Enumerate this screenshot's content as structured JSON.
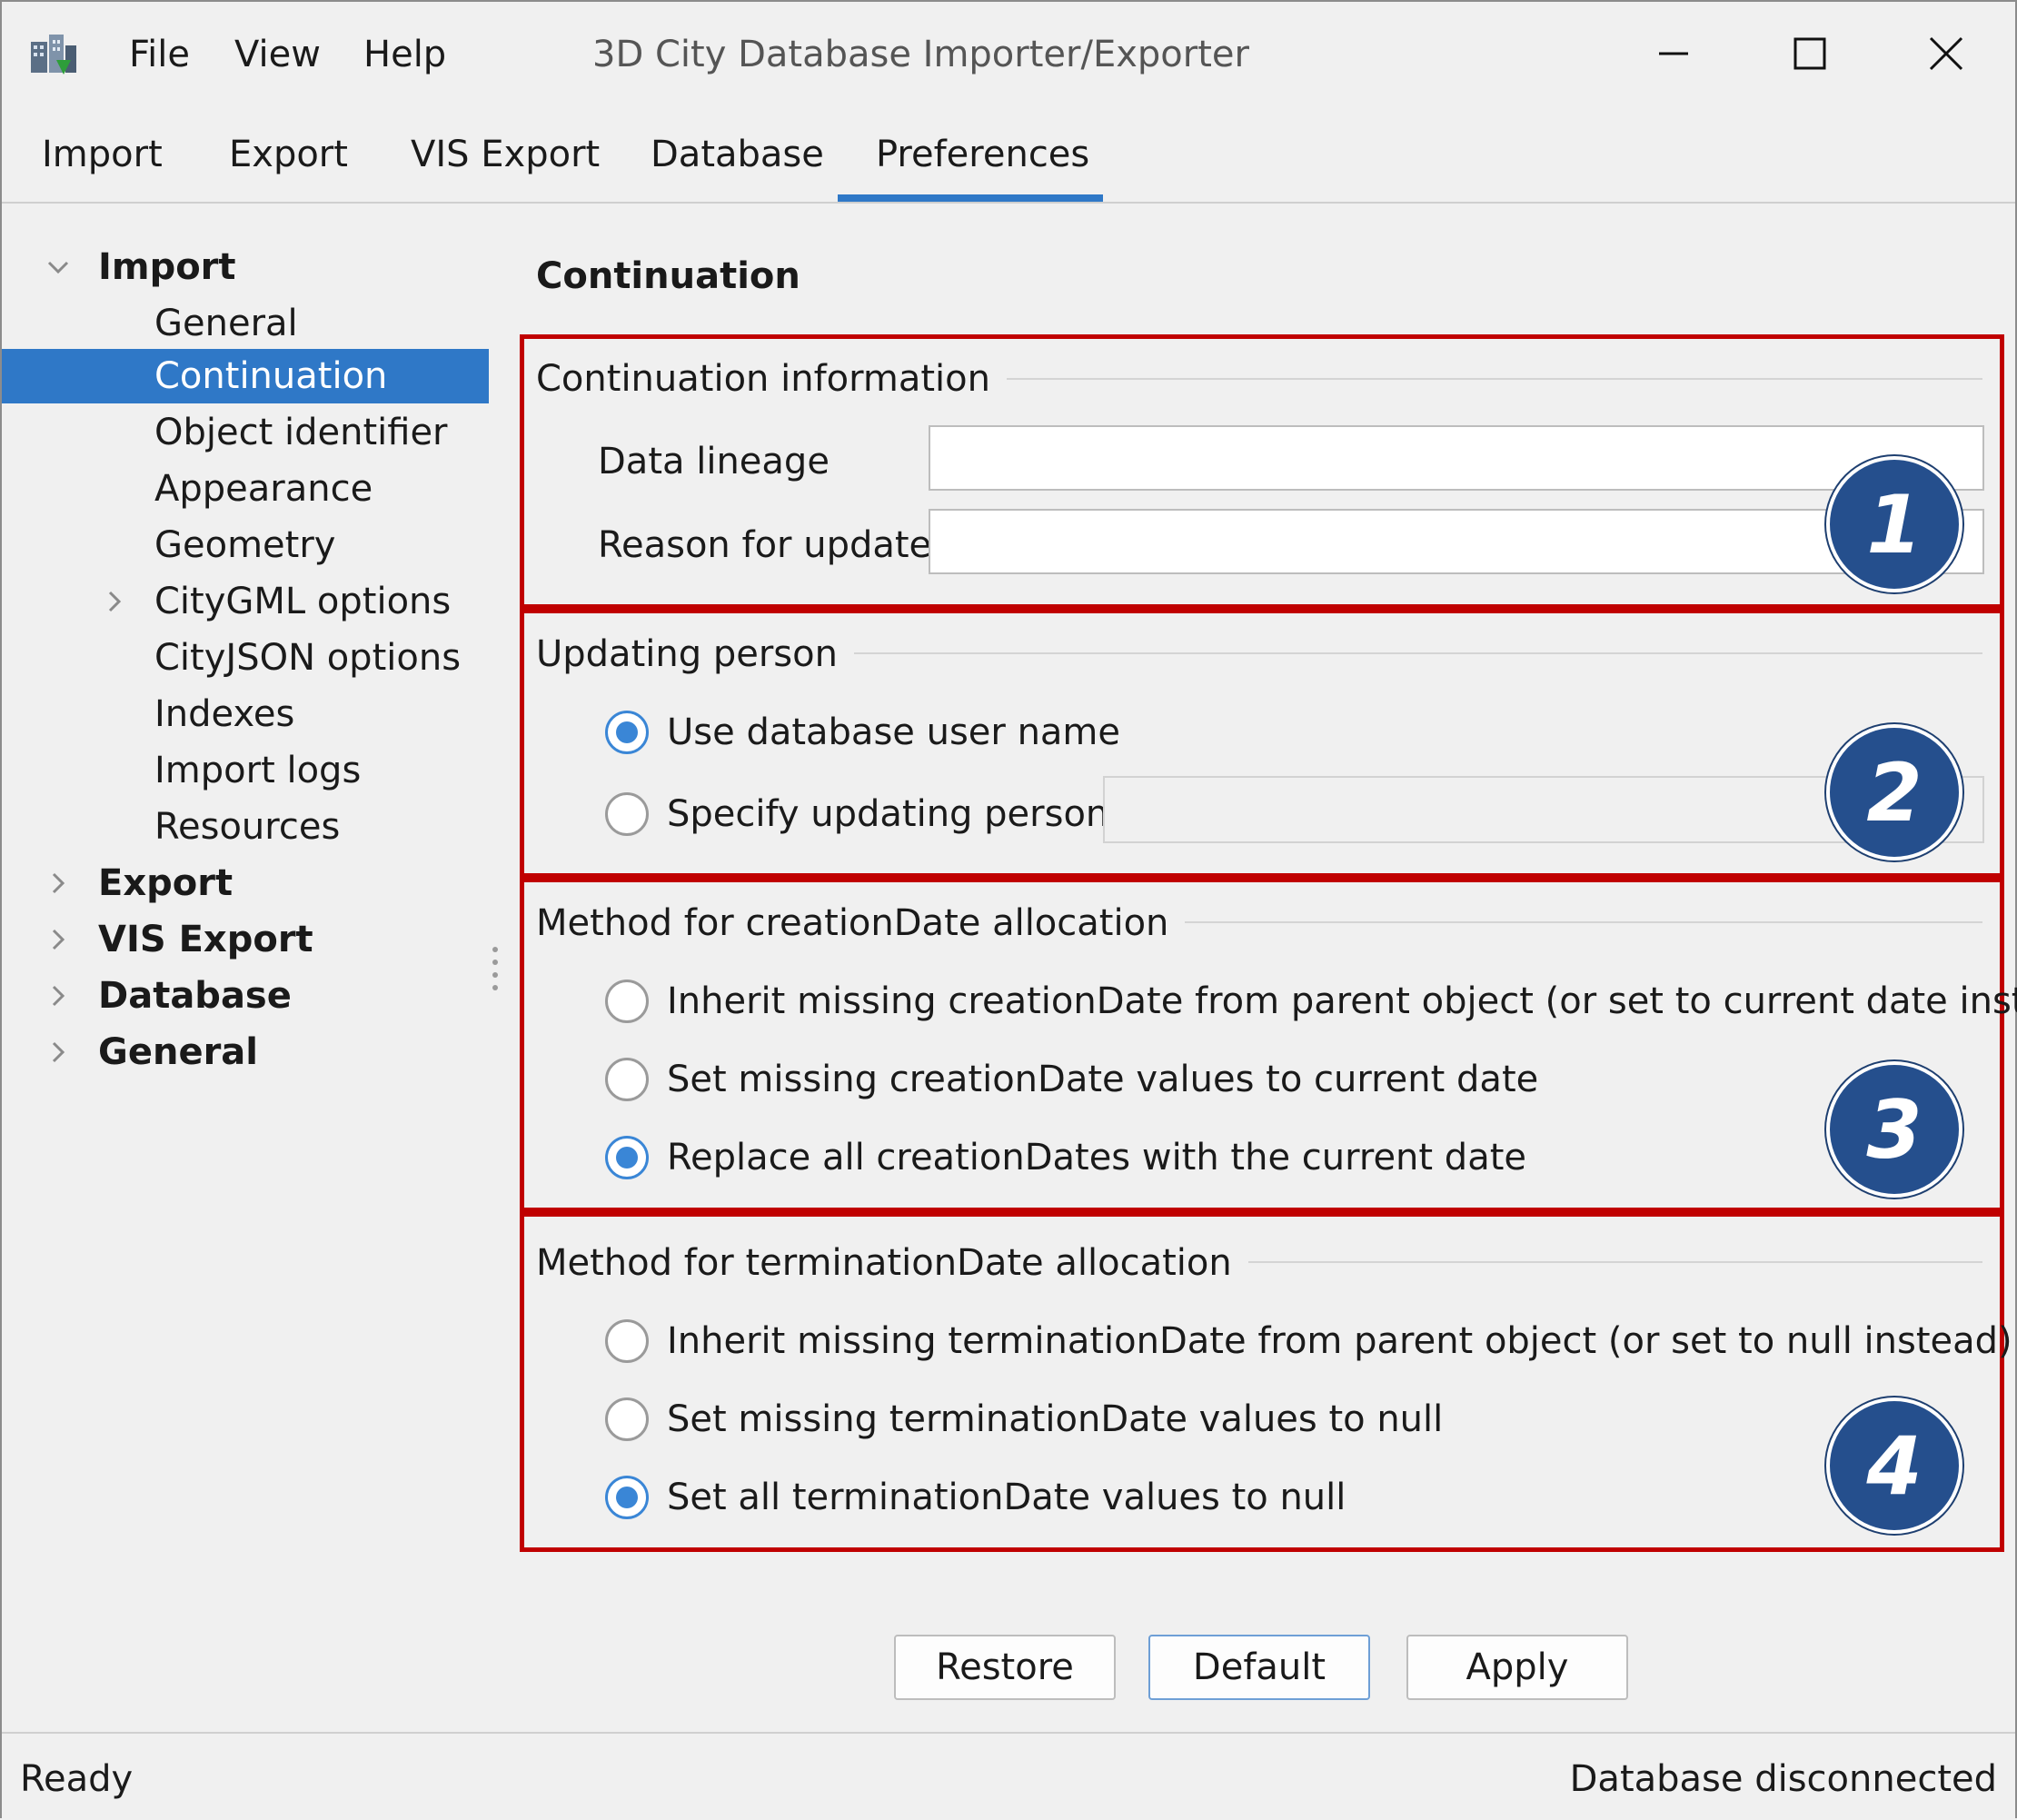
{
  "window": {
    "title": "3D City Database Importer/Exporter",
    "menu": [
      "File",
      "View",
      "Help"
    ]
  },
  "tabs": [
    "Import",
    "Export",
    "VIS Export",
    "Database",
    "Preferences"
  ],
  "active_tab": "Preferences",
  "sidebar": {
    "import_label": "Import",
    "import_children": [
      "General",
      "Continuation",
      "Object identifier",
      "Appearance",
      "Geometry",
      "CityGML options",
      "CityJSON options",
      "Indexes",
      "Import logs",
      "Resources"
    ],
    "selected": "Continuation",
    "other_roots": [
      "Export",
      "VIS Export",
      "Database",
      "General"
    ]
  },
  "content": {
    "title": "Continuation",
    "group1": {
      "title": "Continuation information",
      "data_lineage_label": "Data lineage",
      "data_lineage_value": "",
      "reason_label": "Reason for update",
      "reason_value": "",
      "badge": "1"
    },
    "group2": {
      "title": "Updating person",
      "option_db_user": "Use database user name",
      "option_specify": "Specify updating person",
      "specify_value": "",
      "selected": "Use database user name",
      "badge": "2"
    },
    "group3": {
      "title": "Method for creationDate allocation",
      "options": [
        "Inherit missing creationDate from parent object (or set to current date instead)",
        "Set missing creationDate values to current date",
        "Replace all creationDates with the current date"
      ],
      "selected_index": 2,
      "badge": "3"
    },
    "group4": {
      "title": "Method for terminationDate allocation",
      "options": [
        "Inherit missing terminationDate from parent object (or set to null instead)",
        "Set missing terminationDate values to null",
        "Set all terminationDate values to null"
      ],
      "selected_index": 2,
      "badge": "4"
    },
    "buttons": {
      "restore": "Restore",
      "default": "Default",
      "apply": "Apply"
    }
  },
  "status": {
    "left": "Ready",
    "right": "Database disconnected"
  },
  "colors": {
    "accent": "#2f78c7",
    "highlight_box": "#c00000",
    "badge": "#254f8d"
  }
}
